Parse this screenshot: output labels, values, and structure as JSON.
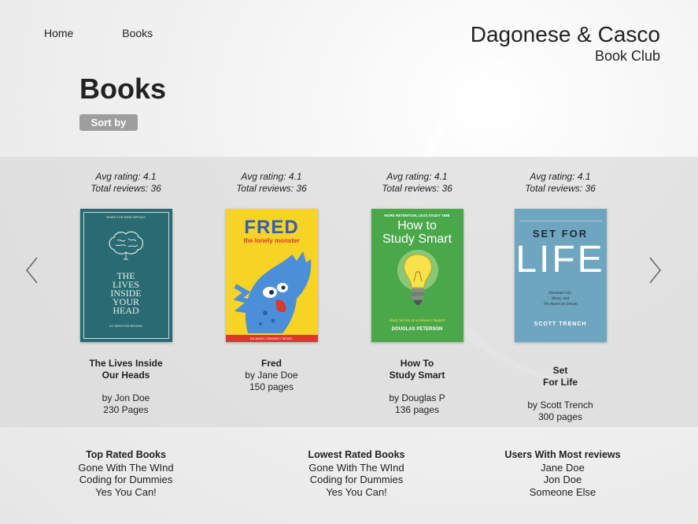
{
  "nav": {
    "home": "Home",
    "books": "Books"
  },
  "brand": {
    "name": "Dagonese & Casco",
    "subtitle": "Book Club"
  },
  "page_title": "Books",
  "sort_label": "Sort by",
  "books": [
    {
      "avg": "Avg rating: 4.1",
      "total": "Total reviews: 36",
      "title1": "The Lives Inside",
      "title2": "Our Heads",
      "author": "by Jon Doe",
      "pages": "230 Pages",
      "cover": {
        "bg": "#2a6b73",
        "top": "WHEN THE MIND SPEAKS",
        "l1": "THE",
        "l2": "LIVES",
        "l3": "INSIDE",
        "l4": "YOUR",
        "l5": "HEAD",
        "author": "BY WINSTON BROWN"
      }
    },
    {
      "avg": "Avg rating: 4.1",
      "total": "Total reviews: 36",
      "title1": "Fred",
      "title2": "",
      "author": "by Jane Doe",
      "pages": "150 pages",
      "cover": {
        "bg": "#f6d324",
        "l1": "FRED",
        "l2": "the lonely monster",
        "bottom": "AN ANNE LOWINSKY NOVEL"
      }
    },
    {
      "avg": "Avg rating: 4.1",
      "total": "Total reviews: 36",
      "title1": "How To",
      "title2": "Study Smart",
      "author": "by Douglas  P",
      "pages": "136 pages",
      "cover": {
        "bg": "#4aa84a",
        "top": "MORE RETENTION, LESS STUDY TIME",
        "l1": "How to",
        "l2": "Study Smart",
        "sub": "Study Secrets of an Honors Student",
        "author": "DOUGLAS PETERSON"
      }
    },
    {
      "avg": "Avg rating: 4.1",
      "total": "Total reviews: 36",
      "title1": "Set",
      "title2": "For Life",
      "author": "by Scott Trench",
      "pages": "300 pages",
      "cover": {
        "bg": "#6fa6bf",
        "l1": "SET FOR",
        "l2": "LIFE",
        "sub1": "Dominate Life,",
        "sub2": "Money and",
        "sub3": "The American Dream",
        "author": "SCOTT TRENCH"
      }
    }
  ],
  "footer": {
    "top_rated": {
      "heading": "Top Rated Books",
      "items": [
        "Gone With The WInd",
        "Coding for Dummies",
        "Yes You Can!"
      ]
    },
    "lowest_rated": {
      "heading": "Lowest Rated Books",
      "items": [
        "Gone With The WInd",
        "Coding for Dummies",
        "Yes You Can!"
      ]
    },
    "most_reviews": {
      "heading": "Users With Most reviews",
      "items": [
        "Jane Doe",
        "Jon Doe",
        "Someone Else"
      ]
    }
  }
}
